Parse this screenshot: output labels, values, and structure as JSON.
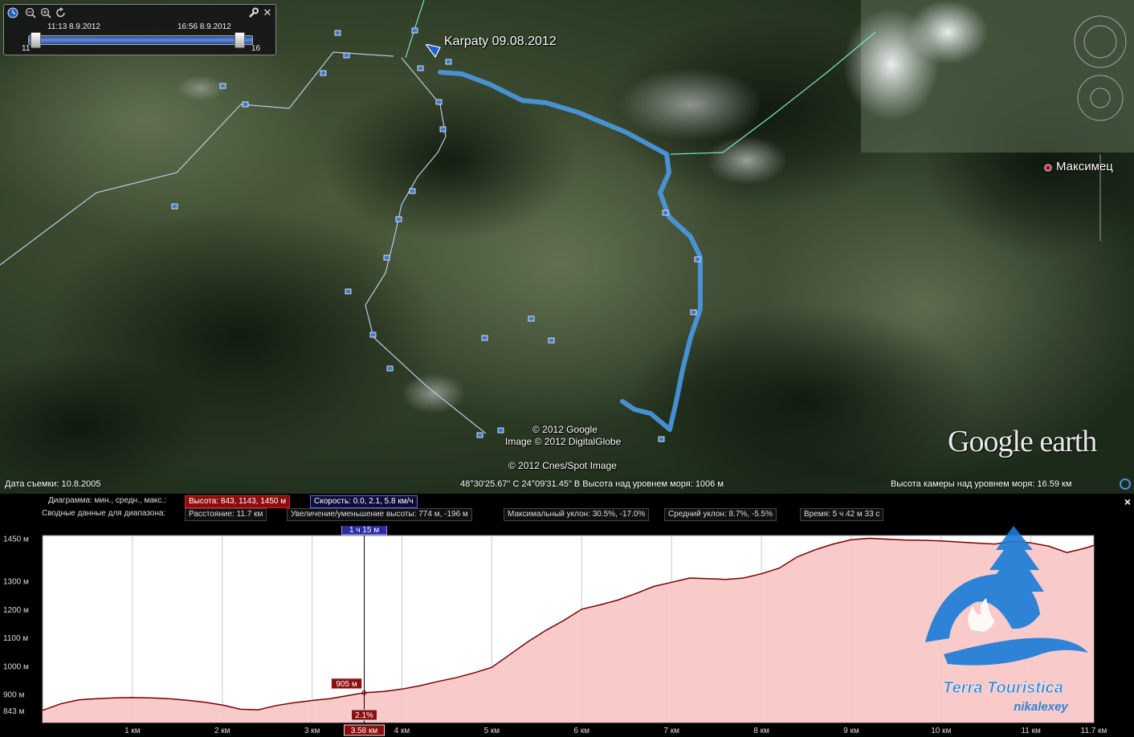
{
  "map": {
    "track_name": "Karpaty 09.08.2012",
    "place_label": "Максимец",
    "copyright": [
      "© 2012 Google",
      "Image © 2012 DigitalGlobe",
      "© 2012 Cnes/Spot Image"
    ],
    "logo": "Google earth",
    "status": {
      "imagery_date": "Дата съемки: 10.8.2005",
      "coordinates": "48°30'25.67\" С  24°09'31.45\" В Высота над уровнем моря:  1006 м",
      "camera_altitude": "Высота камеры над уровнем моря:    16.59 км"
    },
    "colors": {
      "track": "#4a9ae6",
      "border_line": "#b8c8e8",
      "cyan_line": "#7fe6c8"
    }
  },
  "time_control": {
    "start_label": "11:13 8.9.2012",
    "end_label": "16:56 8.9.2012",
    "start_num": "11",
    "end_num": "16",
    "icons": [
      "clock-icon",
      "zoom-out-icon",
      "zoom-in-icon",
      "loop-icon",
      "wrench-icon",
      "close-icon"
    ]
  },
  "profile": {
    "row1": {
      "label": "Диаграмма: мин., средн., макс.:",
      "altitude": "Высота: 843, 1143, 1450 м",
      "speed": "Скорость: 0.0, 2.1, 5.8 км/ч"
    },
    "row2": {
      "label": "Сводные данные для диапазона:",
      "distance": "Расстояние: 11.7 км",
      "elev_change": "Увеличение/уменьшение высоты: 774 м, -196 м",
      "max_slope": "Максимальный уклон: 30.5%, -17.0%",
      "avg_slope": "Средний уклон: 8.7%, -5.5%",
      "time": "Время: 5 ч 42 м 33 с"
    },
    "close": "×",
    "cursor": {
      "time": "1 ч 15 м",
      "elevation": "905 м",
      "slope": "2.1%",
      "distance": "3.58 км",
      "x_km": 3.58
    },
    "watermark": {
      "line1": "Terra Touristica",
      "line2": "nikalexey"
    }
  },
  "chart_data": {
    "type": "area",
    "title": "",
    "xlabel": "",
    "ylabel": "",
    "xlim": [
      0,
      11.7
    ],
    "ylim": [
      800,
      1460
    ],
    "x_ticks": [
      1,
      2,
      3,
      4,
      5,
      6,
      7,
      8,
      9,
      10,
      11,
      11.7
    ],
    "x_tick_labels": [
      "1 км",
      "2 км",
      "3 км",
      "4 км",
      "5 км",
      "6 км",
      "7 км",
      "8 км",
      "9 км",
      "10 км",
      "11 км",
      "11.7 км"
    ],
    "y_ticks": [
      843,
      900,
      1000,
      1100,
      1200,
      1300,
      1450
    ],
    "y_tick_labels": [
      "843 м",
      "900 м",
      "1000 м",
      "1100 м",
      "1200 м",
      "1300 м",
      "1450 м"
    ],
    "grid": true,
    "colors": {
      "line": "#7a0000",
      "fill": "#f7c4c4"
    },
    "series": [
      {
        "x": [
          0,
          0.2,
          0.4,
          0.6,
          0.8,
          1.0,
          1.2,
          1.4,
          1.6,
          1.8,
          2.0,
          2.2,
          2.4,
          2.6,
          2.8,
          3.0,
          3.2,
          3.58,
          3.8,
          4.0,
          4.2,
          4.4,
          4.6,
          4.8,
          5.0,
          5.2,
          5.4,
          5.6,
          5.8,
          6.0,
          6.2,
          6.4,
          6.6,
          6.8,
          7.0,
          7.2,
          7.4,
          7.6,
          7.8,
          8.0,
          8.2,
          8.4,
          8.6,
          8.8,
          9.0,
          9.2,
          9.4,
          9.6,
          9.8,
          10.0,
          10.2,
          10.4,
          10.6,
          10.8,
          11.0,
          11.2,
          11.4,
          11.6,
          11.7
        ],
        "y": [
          843,
          866,
          880,
          884,
          887,
          888,
          887,
          884,
          879,
          872,
          862,
          847,
          845,
          860,
          870,
          878,
          884,
          905,
          910,
          918,
          930,
          945,
          958,
          975,
          995,
          1040,
          1085,
          1125,
          1160,
          1200,
          1215,
          1232,
          1255,
          1280,
          1295,
          1310,
          1308,
          1305,
          1310,
          1325,
          1345,
          1385,
          1410,
          1430,
          1445,
          1450,
          1447,
          1444,
          1443,
          1441,
          1437,
          1433,
          1430,
          1440,
          1434,
          1422,
          1400,
          1415,
          1425
        ]
      }
    ]
  }
}
